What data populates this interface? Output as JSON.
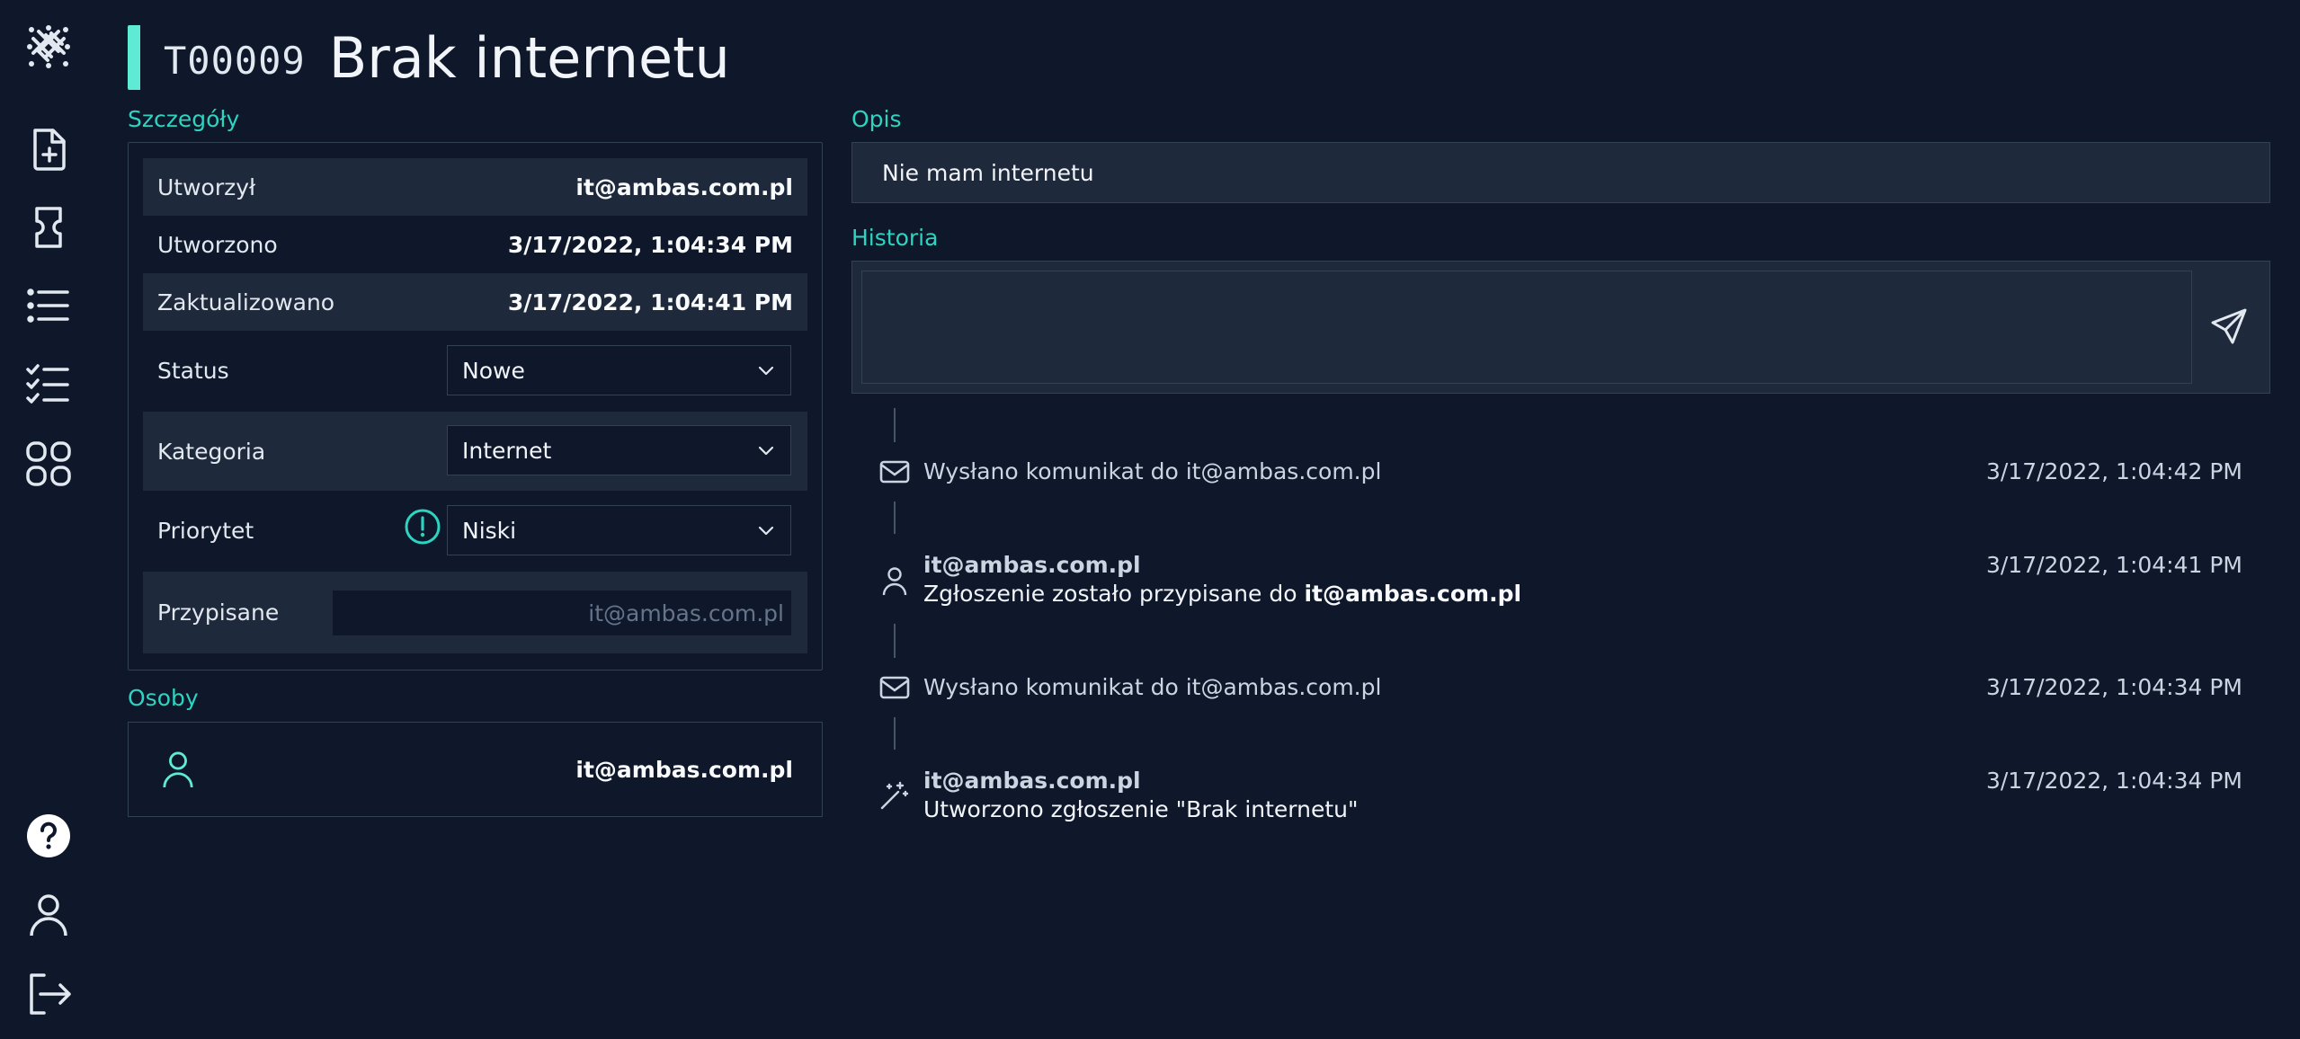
{
  "ticket": {
    "id": "T00009",
    "title": "Brak internetu"
  },
  "sections": {
    "details": "Szczegóły",
    "people": "Osoby",
    "description": "Opis",
    "history": "Historia"
  },
  "details": {
    "created_by": {
      "label": "Utworzył",
      "value": "it@ambas.com.pl"
    },
    "created": {
      "label": "Utworzono",
      "value": "3/17/2022, 1:04:34 PM"
    },
    "updated": {
      "label": "Zaktualizowano",
      "value": "3/17/2022, 1:04:41 PM"
    },
    "status": {
      "label": "Status",
      "value": "Nowe"
    },
    "category": {
      "label": "Kategoria",
      "value": "Internet"
    },
    "priority": {
      "label": "Priorytet",
      "value": "Niski"
    },
    "assigned": {
      "label": "Przypisane",
      "placeholder": "it@ambas.com.pl"
    }
  },
  "people": {
    "person": "it@ambas.com.pl"
  },
  "description": {
    "text": "Nie mam internetu"
  },
  "history": {
    "items": [
      {
        "type": "mail-icon",
        "text": "Wysłano komunikat do it@ambas.com.pl",
        "time": "3/17/2022, 1:04:42 PM"
      },
      {
        "type": "user-icon",
        "author": "it@ambas.com.pl",
        "text_prefix": "Zgłoszenie zostało przypisane do ",
        "text_bold": "it@ambas.com.pl",
        "time": "3/17/2022, 1:04:41 PM"
      },
      {
        "type": "mail-icon",
        "text": "Wysłano komunikat do it@ambas.com.pl",
        "time": "3/17/2022, 1:04:34 PM"
      },
      {
        "type": "magic-wand-icon",
        "author": "it@ambas.com.pl",
        "text": "Utworzono zgłoszenie \"Brak internetu\"",
        "time": "3/17/2022, 1:04:34 PM"
      }
    ]
  },
  "colors": {
    "background": "#0f172a",
    "panel": "#1e293b",
    "accent": "#2dd4bf",
    "border": "#334155"
  }
}
